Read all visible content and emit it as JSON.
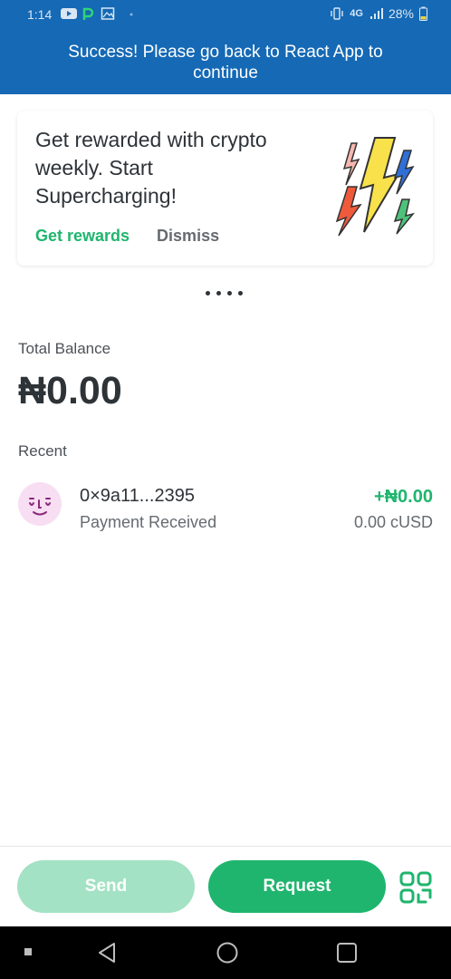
{
  "status_bar": {
    "time": "1:14",
    "network": "4G",
    "battery": "28%"
  },
  "banner": {
    "message": "Success! Please go back to React App to continue"
  },
  "reward_card": {
    "text": "Get rewarded with crypto weekly. Start Supercharging!",
    "primary_action": "Get rewards",
    "secondary_action": "Dismiss"
  },
  "balance": {
    "label": "Total Balance",
    "amount": "₦0.00"
  },
  "recent": {
    "label": "Recent",
    "items": [
      {
        "address": "0×9a11...2395",
        "description": "Payment Received",
        "amount": "+₦0.00",
        "amount_secondary": "0.00 cUSD"
      }
    ]
  },
  "actions": {
    "send": "Send",
    "request": "Request"
  },
  "colors": {
    "header_blue": "#1569b5",
    "accent_green": "#1fb56e",
    "send_disabled": "#a3e2c4",
    "avatar_bg": "#f7def2"
  },
  "icons": [
    "youtube-icon",
    "p-app-icon",
    "image-icon",
    "vibrate-icon",
    "signal-icon",
    "battery-icon",
    "lightning-bolts-icon",
    "avatar-face-icon",
    "qr-scan-icon",
    "back-icon",
    "home-icon",
    "recents-icon"
  ]
}
